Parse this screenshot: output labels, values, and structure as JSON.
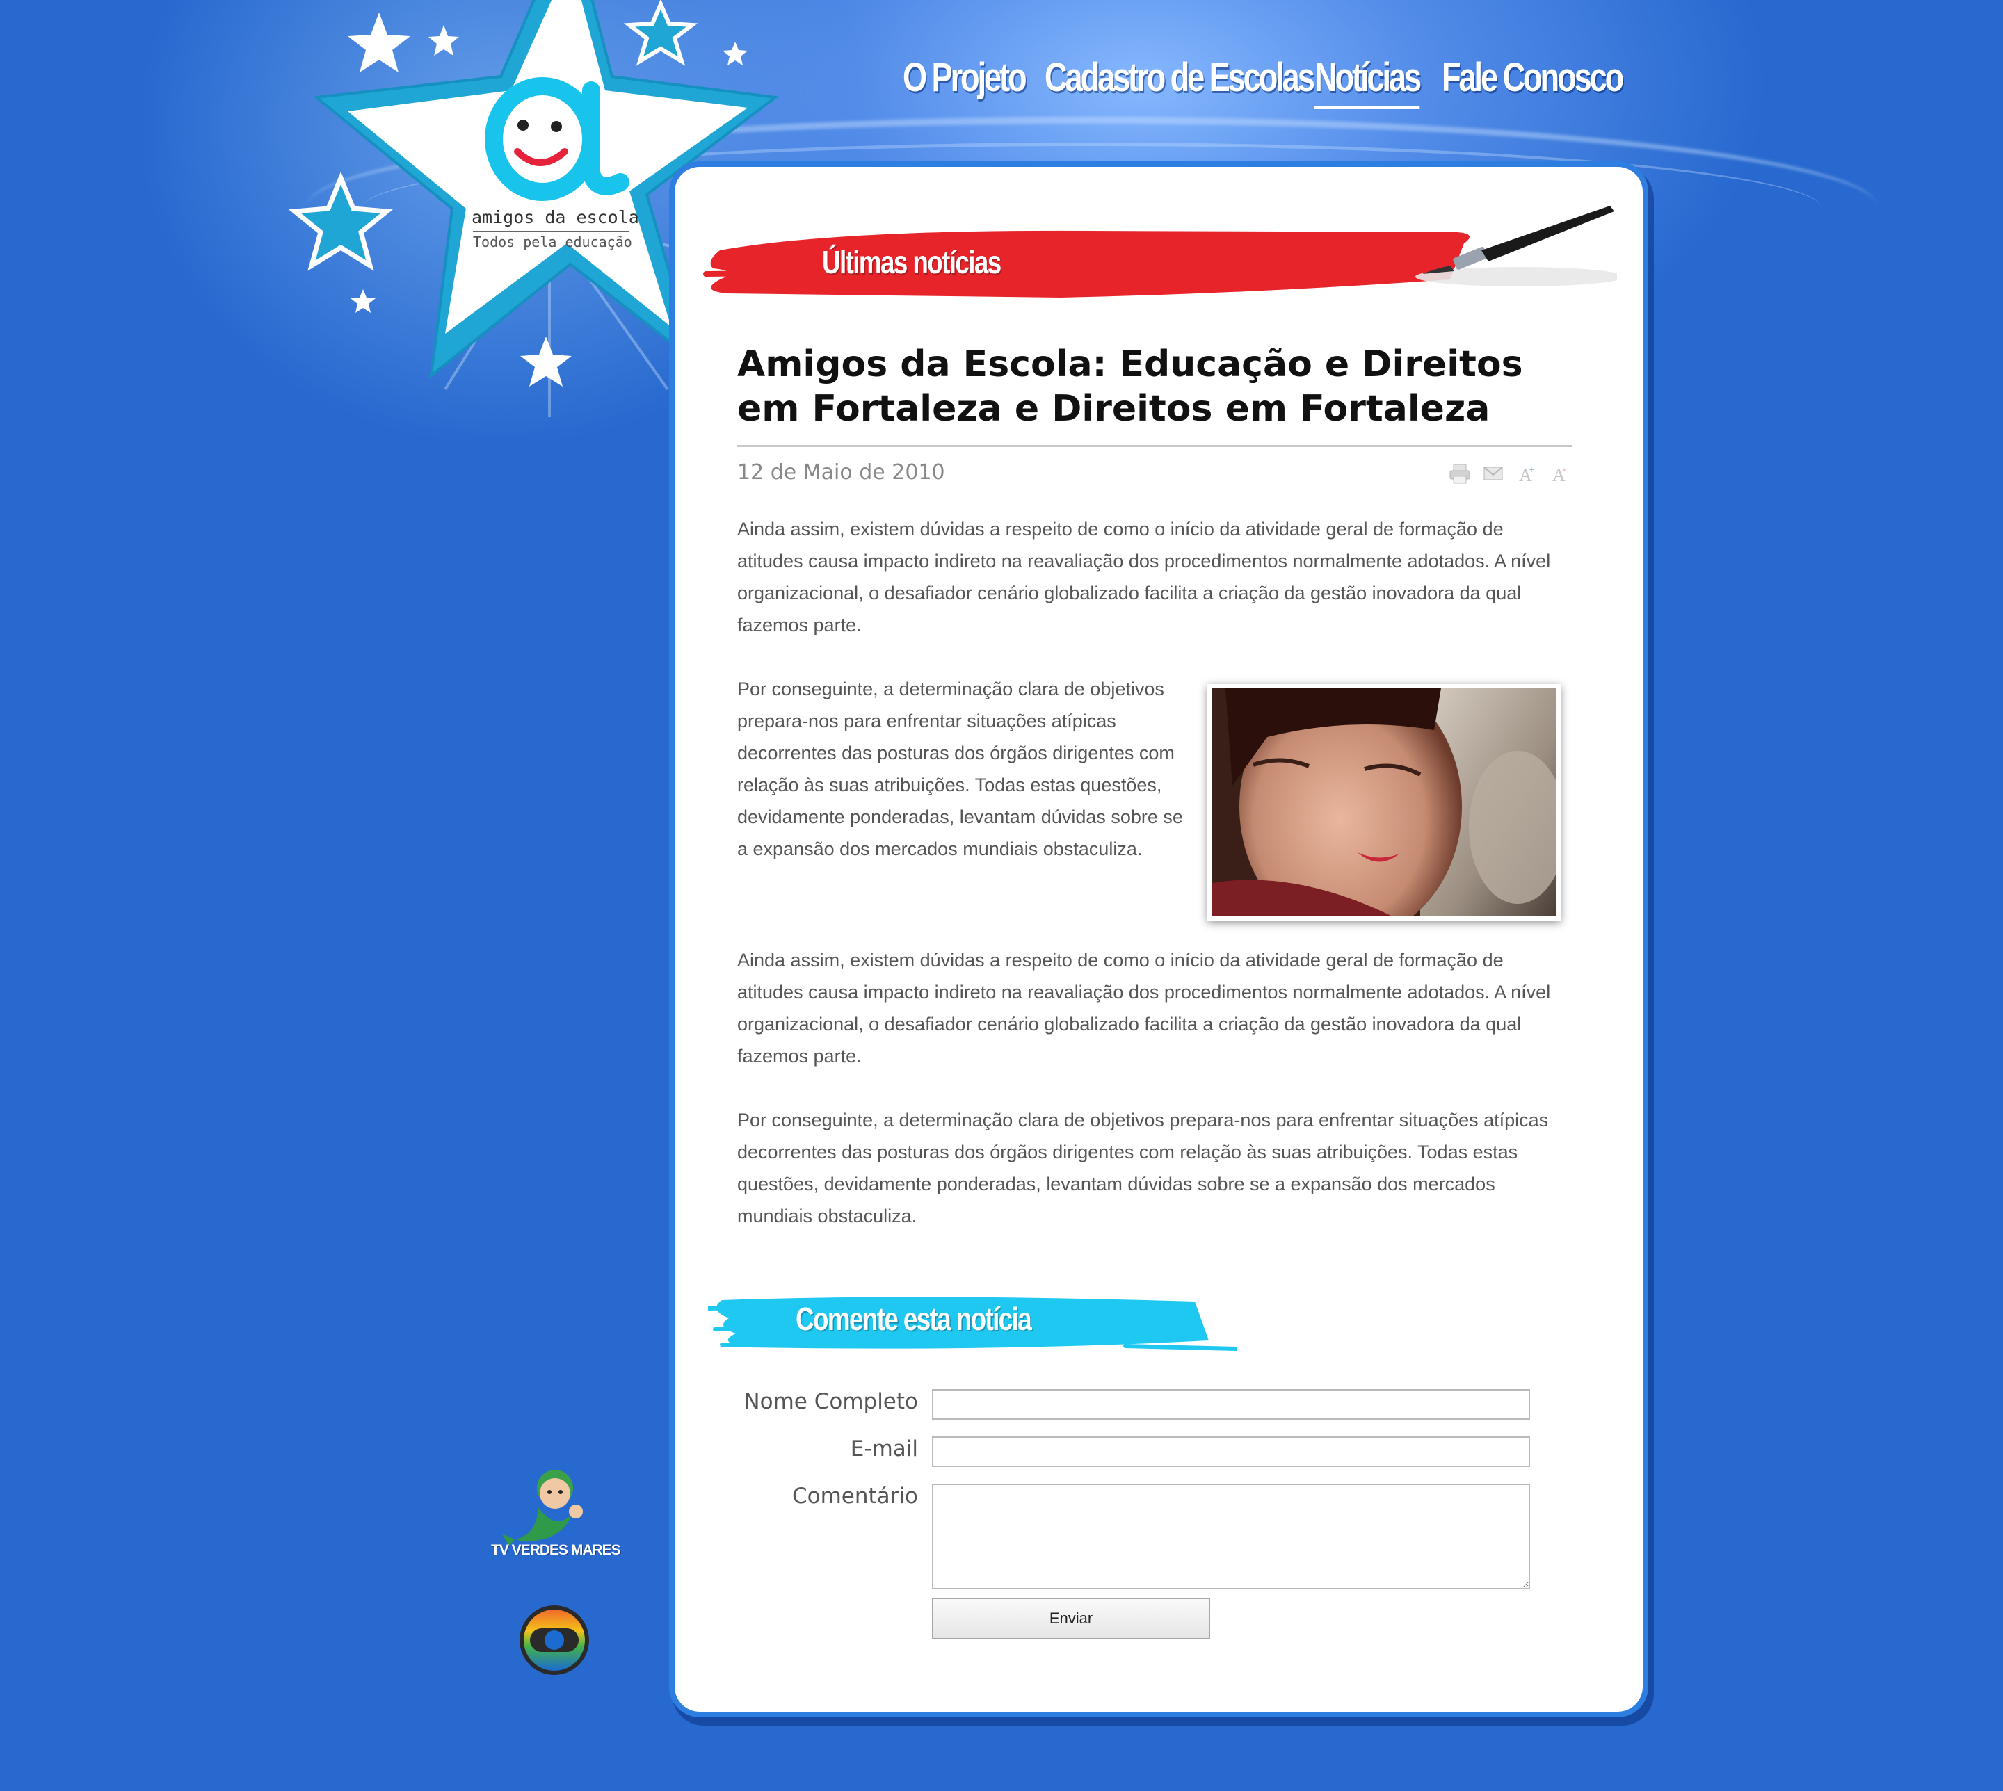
{
  "logo": {
    "name": "amigos da escola",
    "tagline": "Todos pela educação"
  },
  "nav": {
    "items": [
      {
        "label": "O Projeto",
        "active": false
      },
      {
        "label": "Cadastro de Escolas",
        "active": false
      },
      {
        "label": "Notícias",
        "active": true
      },
      {
        "label": "Fale Conosco",
        "active": false
      }
    ]
  },
  "news": {
    "section_title": "Últimas notícias",
    "title": "Amigos da Escola: Educação e Direitos em Fortaleza e Direitos em Fortaleza",
    "date": "12 de Maio de 2010",
    "tools": [
      "print-icon",
      "email-icon",
      "font-increase-icon",
      "font-decrease-icon"
    ],
    "paragraphs": [
      "Ainda assim, existem dúvidas a respeito de como o início da atividade geral de formação de atitudes causa impacto indireto na reavaliação dos procedimentos normalmente adotados. A nível organizacional, o desafiador cenário globalizado facilita a criação da gestão inovadora da qual fazemos parte.",
      "Por conseguinte, a determinação clara de objetivos prepara-nos para enfrentar situações atípicas decorrentes das posturas dos órgãos dirigentes com relação às suas atribuições. Todas estas questões, devidamente ponderadas, levantam dúvidas sobre se a expansão dos mercados mundiais obstaculiza.",
      "Ainda assim, existem dúvidas a respeito de como o início da atividade geral de formação de atitudes causa impacto indireto na reavaliação dos procedimentos normalmente adotados. A nível organizacional, o desafiador cenário globalizado facilita a criação da gestão inovadora da qual fazemos parte.",
      "Por conseguinte, a determinação clara de objetivos prepara-nos para enfrentar situações atípicas decorrentes das posturas dos órgãos dirigentes com relação às suas atribuições. Todas estas questões, devidamente ponderadas, levantam dúvidas sobre se a expansão dos mercados mundiais obstaculiza."
    ]
  },
  "comment": {
    "section_title": "Comente esta notícia",
    "name_label": "Nome Completo",
    "name_value": "",
    "email_label": "E-mail",
    "email_value": "",
    "comment_label": "Comentário",
    "comment_value": "",
    "submit_label": "Enviar"
  },
  "sponsors": {
    "tv_name": "TV VERDES MARES"
  },
  "colors": {
    "background": "#2769cf",
    "banner_red": "#e8242b",
    "banner_cyan": "#1ec8f0",
    "logo_cyan": "#1fa6d4"
  }
}
